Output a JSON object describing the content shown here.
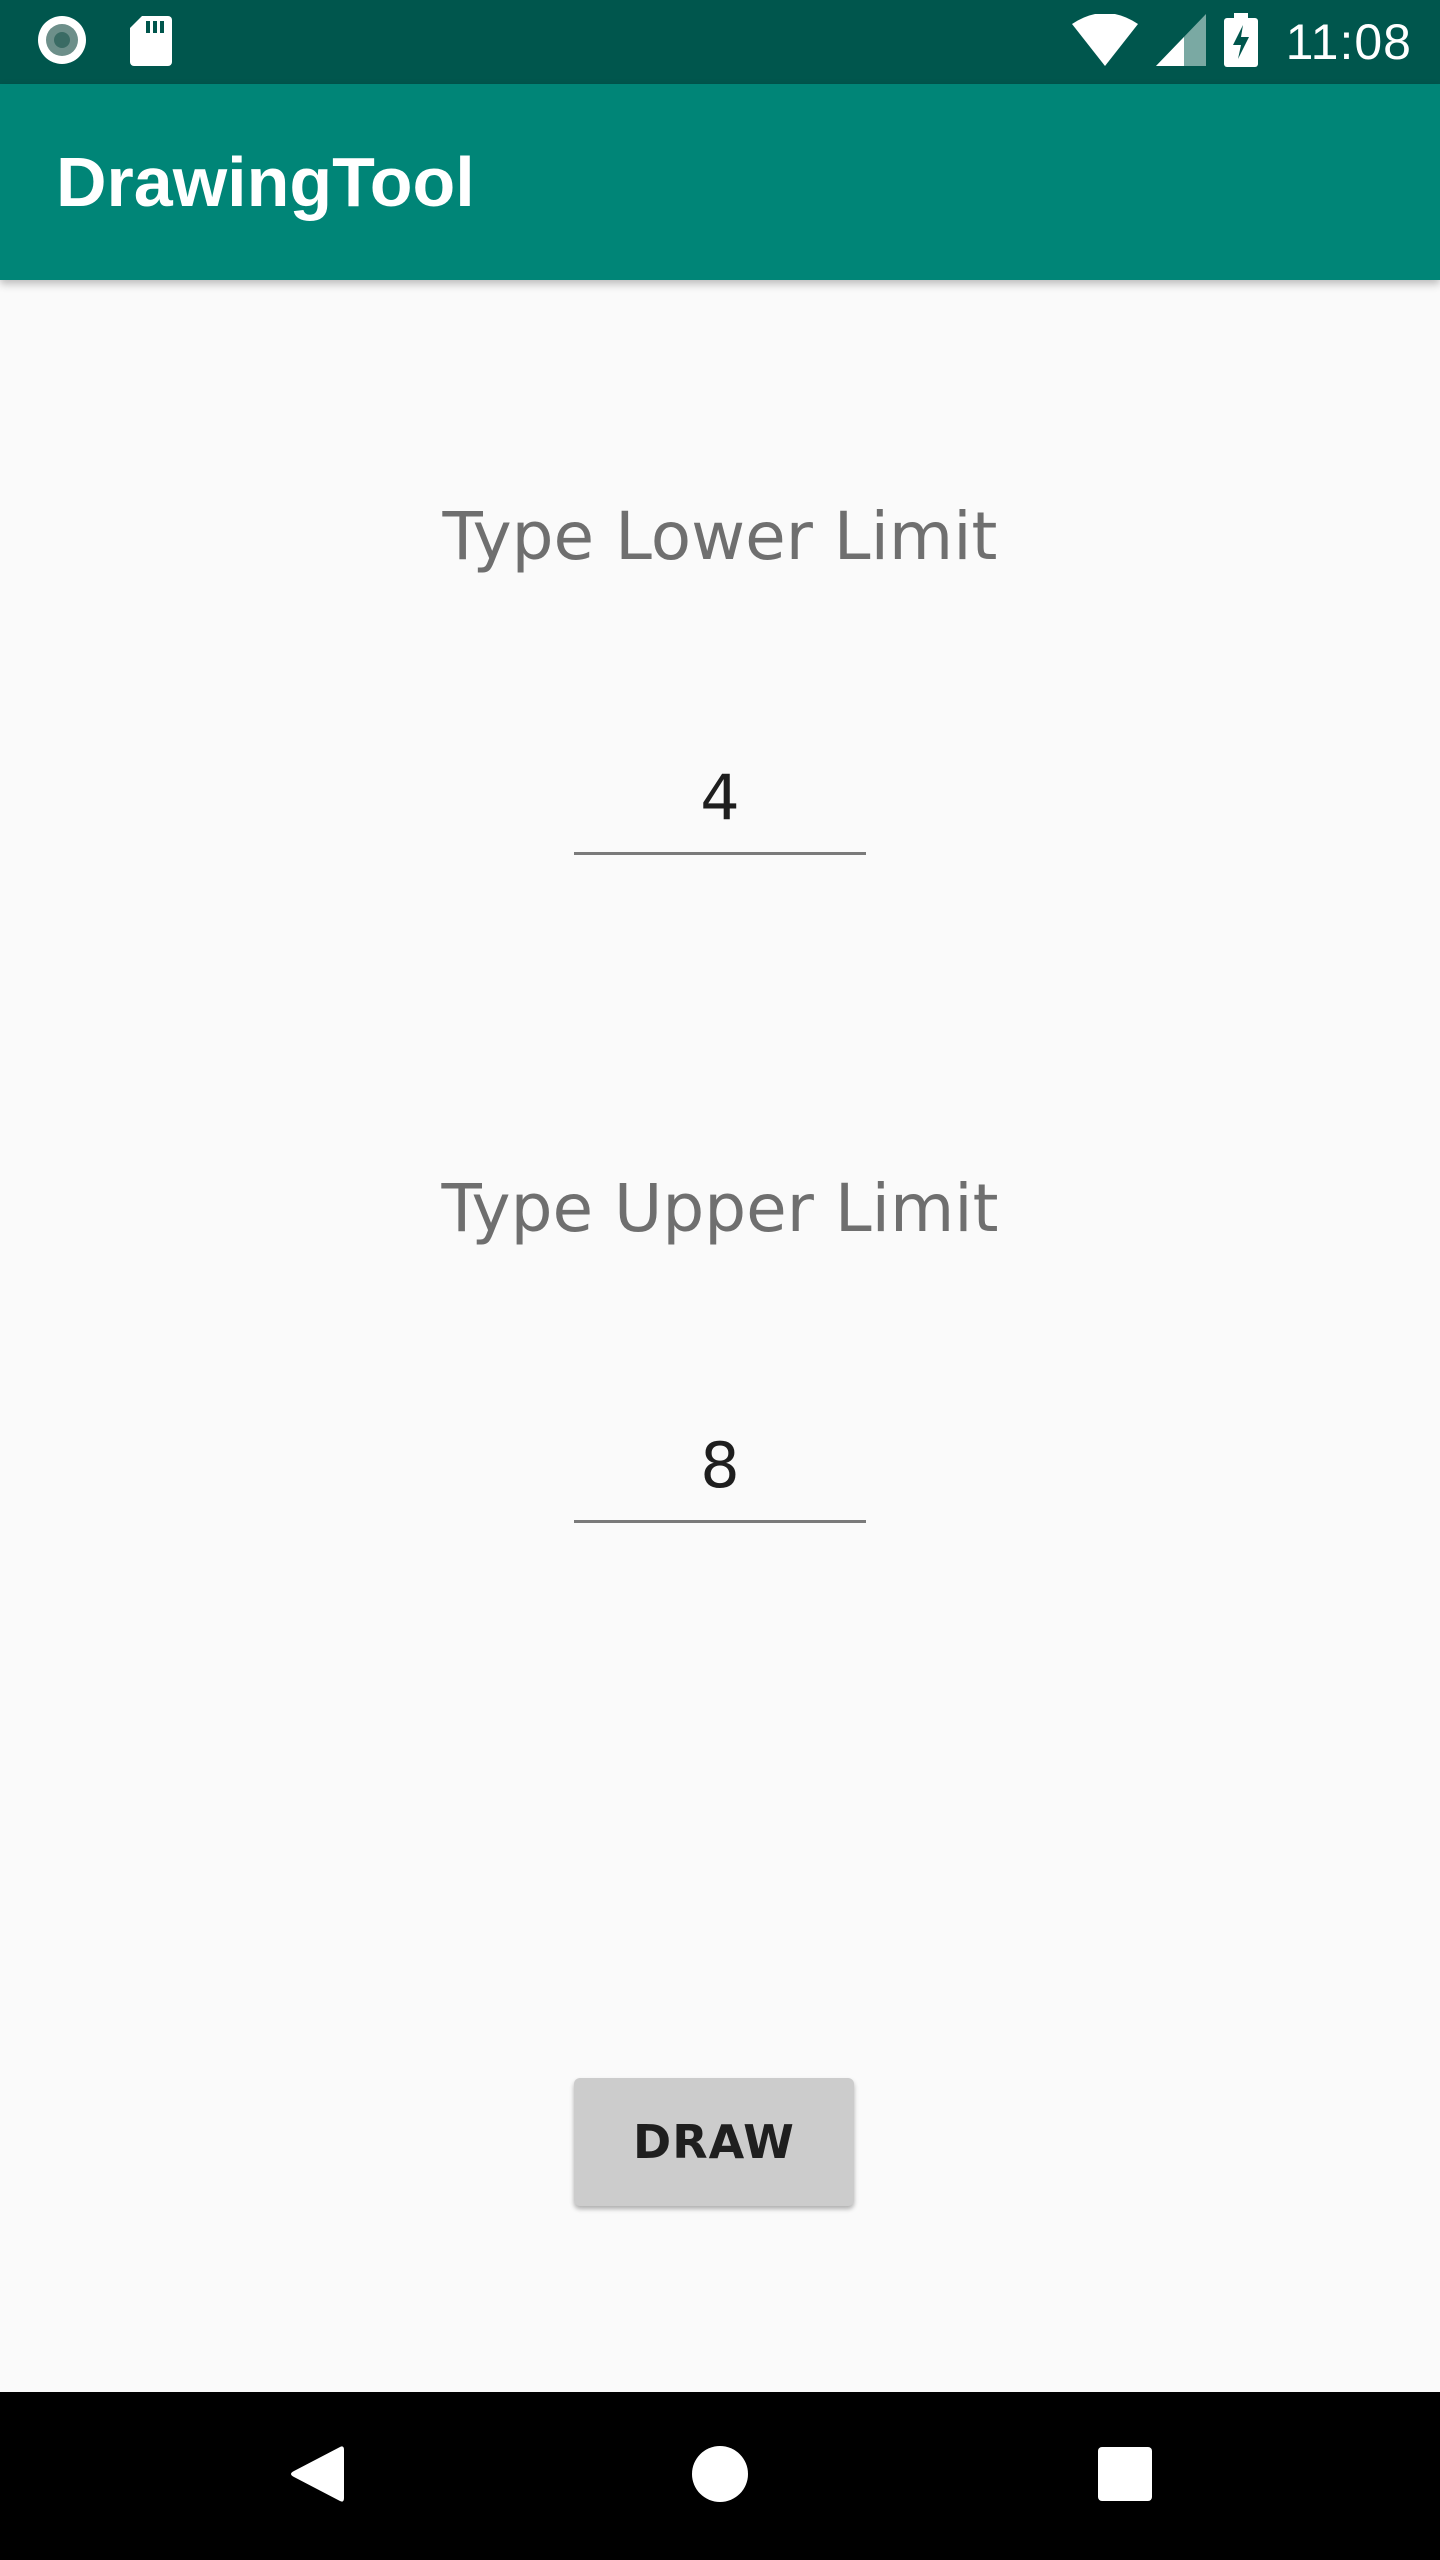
{
  "status_bar": {
    "time": "11:08",
    "icons": [
      "record-icon",
      "sd-card-icon",
      "wifi-icon",
      "cell-signal-icon",
      "battery-charging-icon"
    ]
  },
  "app_bar": {
    "title": "DrawingTool"
  },
  "form": {
    "lower_label": "Type Lower Limit",
    "lower_value": "4",
    "upper_label": "Type Upper Limit",
    "upper_value": "8",
    "draw_button_label": "DRAW"
  },
  "nav_bar": {
    "buttons": [
      "back-icon",
      "home-icon",
      "recents-icon"
    ]
  },
  "colors": {
    "status_bar": "#00564d",
    "app_bar": "#008577",
    "background": "#fafafa",
    "button": "#cccccc"
  }
}
